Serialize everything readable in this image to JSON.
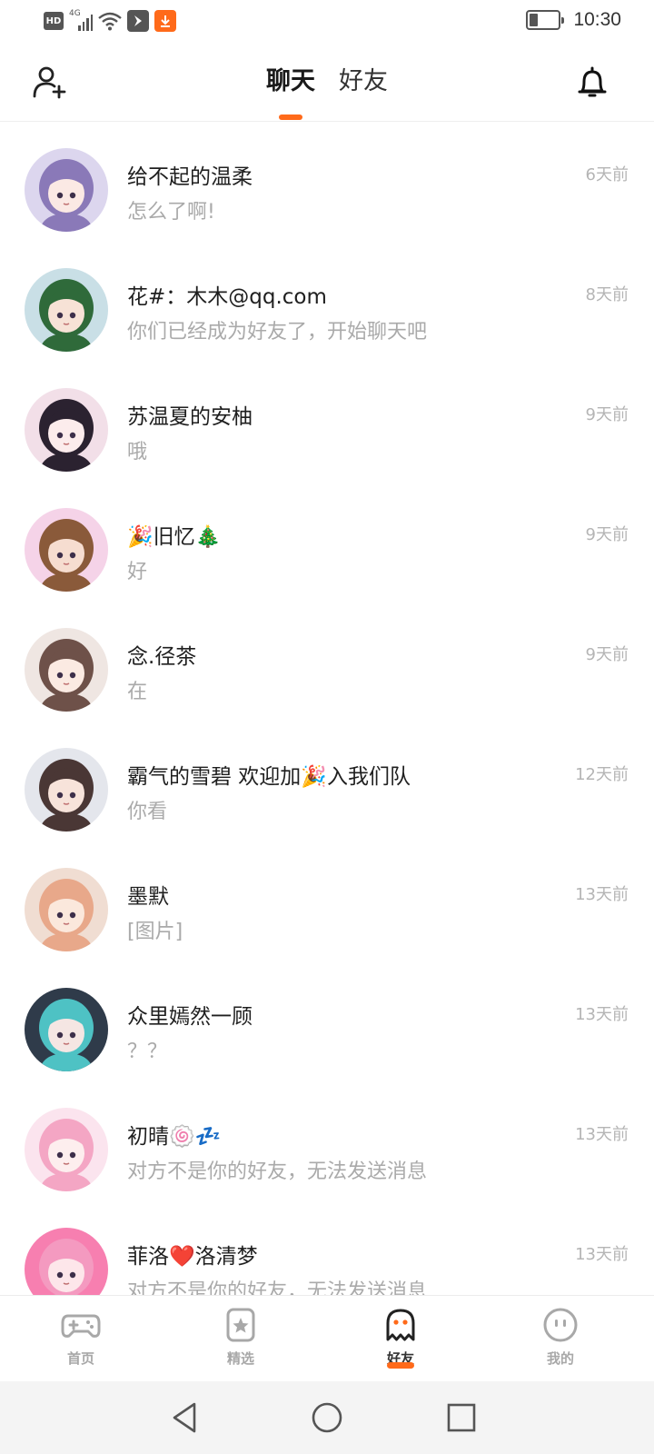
{
  "status_bar": {
    "hd": "HD",
    "network": "4G",
    "time": "10:30",
    "battery_level": 0.3,
    "colors": {
      "download_icon": "#ff6a1a",
      "other_app_icon": "#555555"
    }
  },
  "header": {
    "tabs": [
      {
        "label": "聊天",
        "active": true
      },
      {
        "label": "好友",
        "active": false
      }
    ],
    "accent": "#ff6a1a"
  },
  "chats": [
    {
      "name": "给不起的温柔",
      "preview": "怎么了啊!",
      "time": "6天前",
      "avatar": {
        "bg": "#dcd6ee",
        "hair": "#8a79b8",
        "skin": "#fbe9e4"
      }
    },
    {
      "name": "花#：木木@qq.com",
      "preview": "你们已经成为好友了，开始聊天吧",
      "time": "8天前",
      "avatar": {
        "bg": "#c9dfe6",
        "hair": "#2f6a3a",
        "skin": "#f7e2d6"
      }
    },
    {
      "name": "苏温夏的安柚",
      "preview": "哦",
      "time": "9天前",
      "avatar": {
        "bg": "#f2dfe8",
        "hair": "#2b2230",
        "skin": "#fcecec"
      }
    },
    {
      "name": "🎉旧忆🎄",
      "preview": "好",
      "time": "9天前",
      "avatar": {
        "bg": "#f5d3e8",
        "hair": "#8a5a3a",
        "skin": "#f6ddd0"
      }
    },
    {
      "name": "念.径茶",
      "preview": "在",
      "time": "9天前",
      "avatar": {
        "bg": "#efe6e2",
        "hair": "#6e5149",
        "skin": "#fbeae2"
      }
    },
    {
      "name": "霸气的雪碧 欢迎加🎉入我们队",
      "preview": "你看",
      "time": "12天前",
      "avatar": {
        "bg": "#e4e6ec",
        "hair": "#4a3735",
        "skin": "#f7e3da"
      }
    },
    {
      "name": "墨默",
      "preview": "[图片]",
      "time": "13天前",
      "avatar": {
        "bg": "#f0ddd2",
        "hair": "#e8a88a",
        "skin": "#fbe8dc"
      }
    },
    {
      "name": "众里嫣然一顾",
      "preview": "？？",
      "time": "13天前",
      "avatar": {
        "bg": "#2f3b4a",
        "hair": "#4ec2c4",
        "skin": "#f5e6e3"
      }
    },
    {
      "name": "初晴🍥💤",
      "preview": "对方不是你的好友，无法发送消息",
      "time": "13天前",
      "avatar": {
        "bg": "#fbe4ee",
        "hair": "#f4a6c4",
        "skin": "#fdeeee"
      }
    },
    {
      "name": "菲洛❤️洛清梦",
      "preview": "对方不是你的好友，无法发送消息",
      "time": "13天前",
      "avatar": {
        "bg": "#f77fb0",
        "hair": "#f49ac0",
        "skin": "#fde6ea"
      }
    }
  ],
  "bottom_nav": [
    {
      "label": "首页",
      "icon": "gamepad-icon",
      "active": false
    },
    {
      "label": "精选",
      "icon": "star-icon",
      "active": false
    },
    {
      "label": "好友",
      "icon": "ghost-icon",
      "active": true
    },
    {
      "label": "我的",
      "icon": "face-icon",
      "active": false
    }
  ],
  "system_nav": [
    "back-icon",
    "home-icon",
    "recents-icon"
  ]
}
